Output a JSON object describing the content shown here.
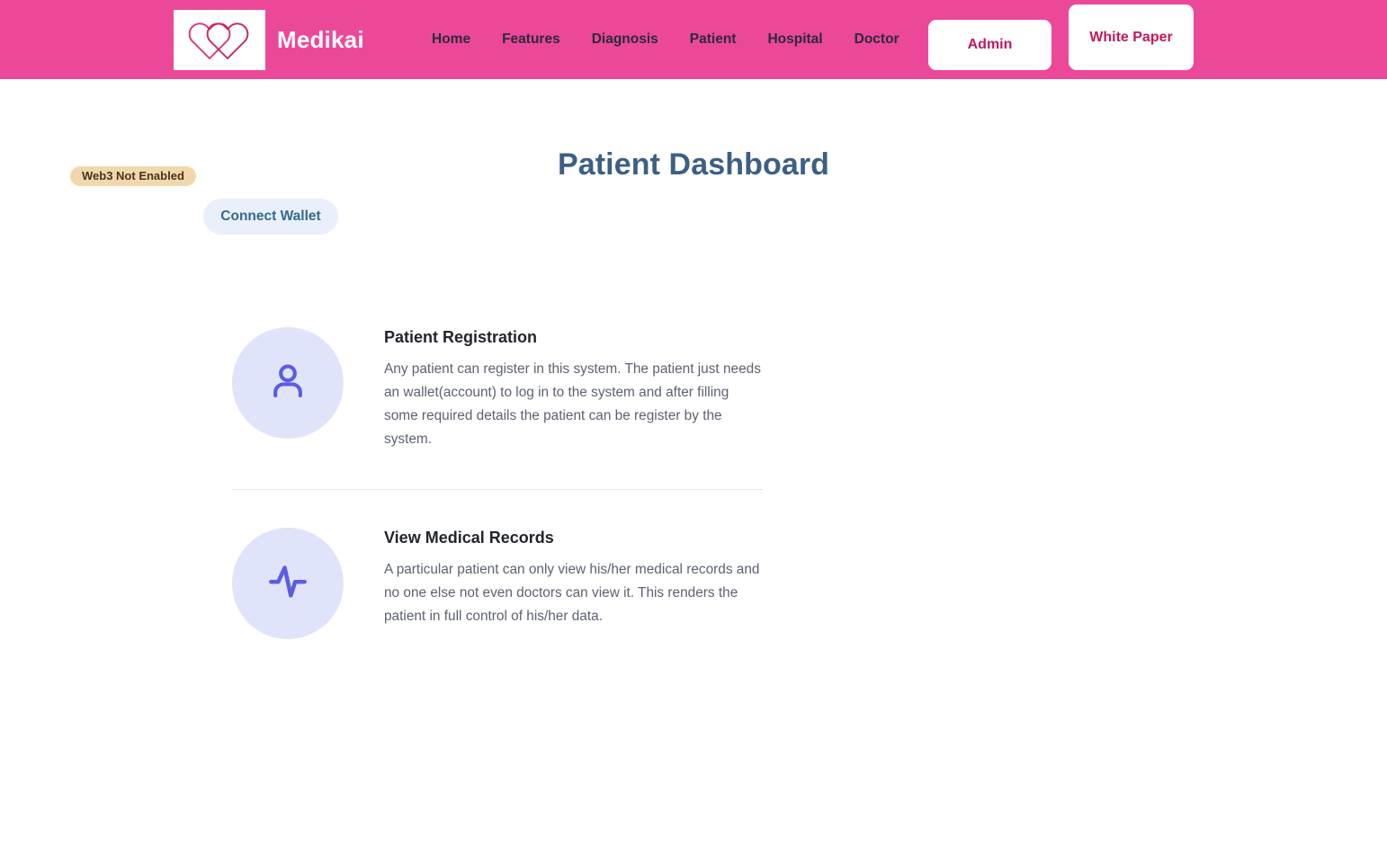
{
  "header": {
    "brand_name": "Medikai",
    "logo_icon": "interlocking-hearts-logo",
    "nav_links": [
      {
        "label": "Home"
      },
      {
        "label": "Features"
      },
      {
        "label": "Diagnosis"
      },
      {
        "label": "Patient"
      },
      {
        "label": "Hospital"
      },
      {
        "label": "Doctor"
      }
    ],
    "admin_button": "Admin",
    "whitepaper_button": "White Paper",
    "colors": {
      "bar_background": "#ec4899",
      "button_text": "#c2185b",
      "nav_link_text": "#2b2b3c"
    }
  },
  "main": {
    "page_title": "Patient Dashboard",
    "page_title_color": "#3c5f85",
    "web3_badge": {
      "label": "Web3 Not Enabled",
      "background": "#f2d7ae",
      "text_color": "#4a3418"
    },
    "connect_wallet_button": {
      "label": "Connect Wallet",
      "background": "#e9f0fb",
      "text_color": "#36688f"
    },
    "cards": [
      {
        "icon": "user-icon",
        "icon_background": "#dfe4fb",
        "icon_color": "#5b5ce3",
        "title": "Patient Registration",
        "text": "Any patient can register in this system. The patient just needs an wallet(account) to log in to the system and after filling some required details the patient can be register by the system."
      },
      {
        "icon": "activity-pulse-icon",
        "icon_background": "#dfe4fb",
        "icon_color": "#5b5ce3",
        "title": "View Medical Records",
        "text": "A particular patient can only view his/her medical records and no one else not even doctors can view it. This renders the patient in full control of his/her data."
      }
    ]
  }
}
